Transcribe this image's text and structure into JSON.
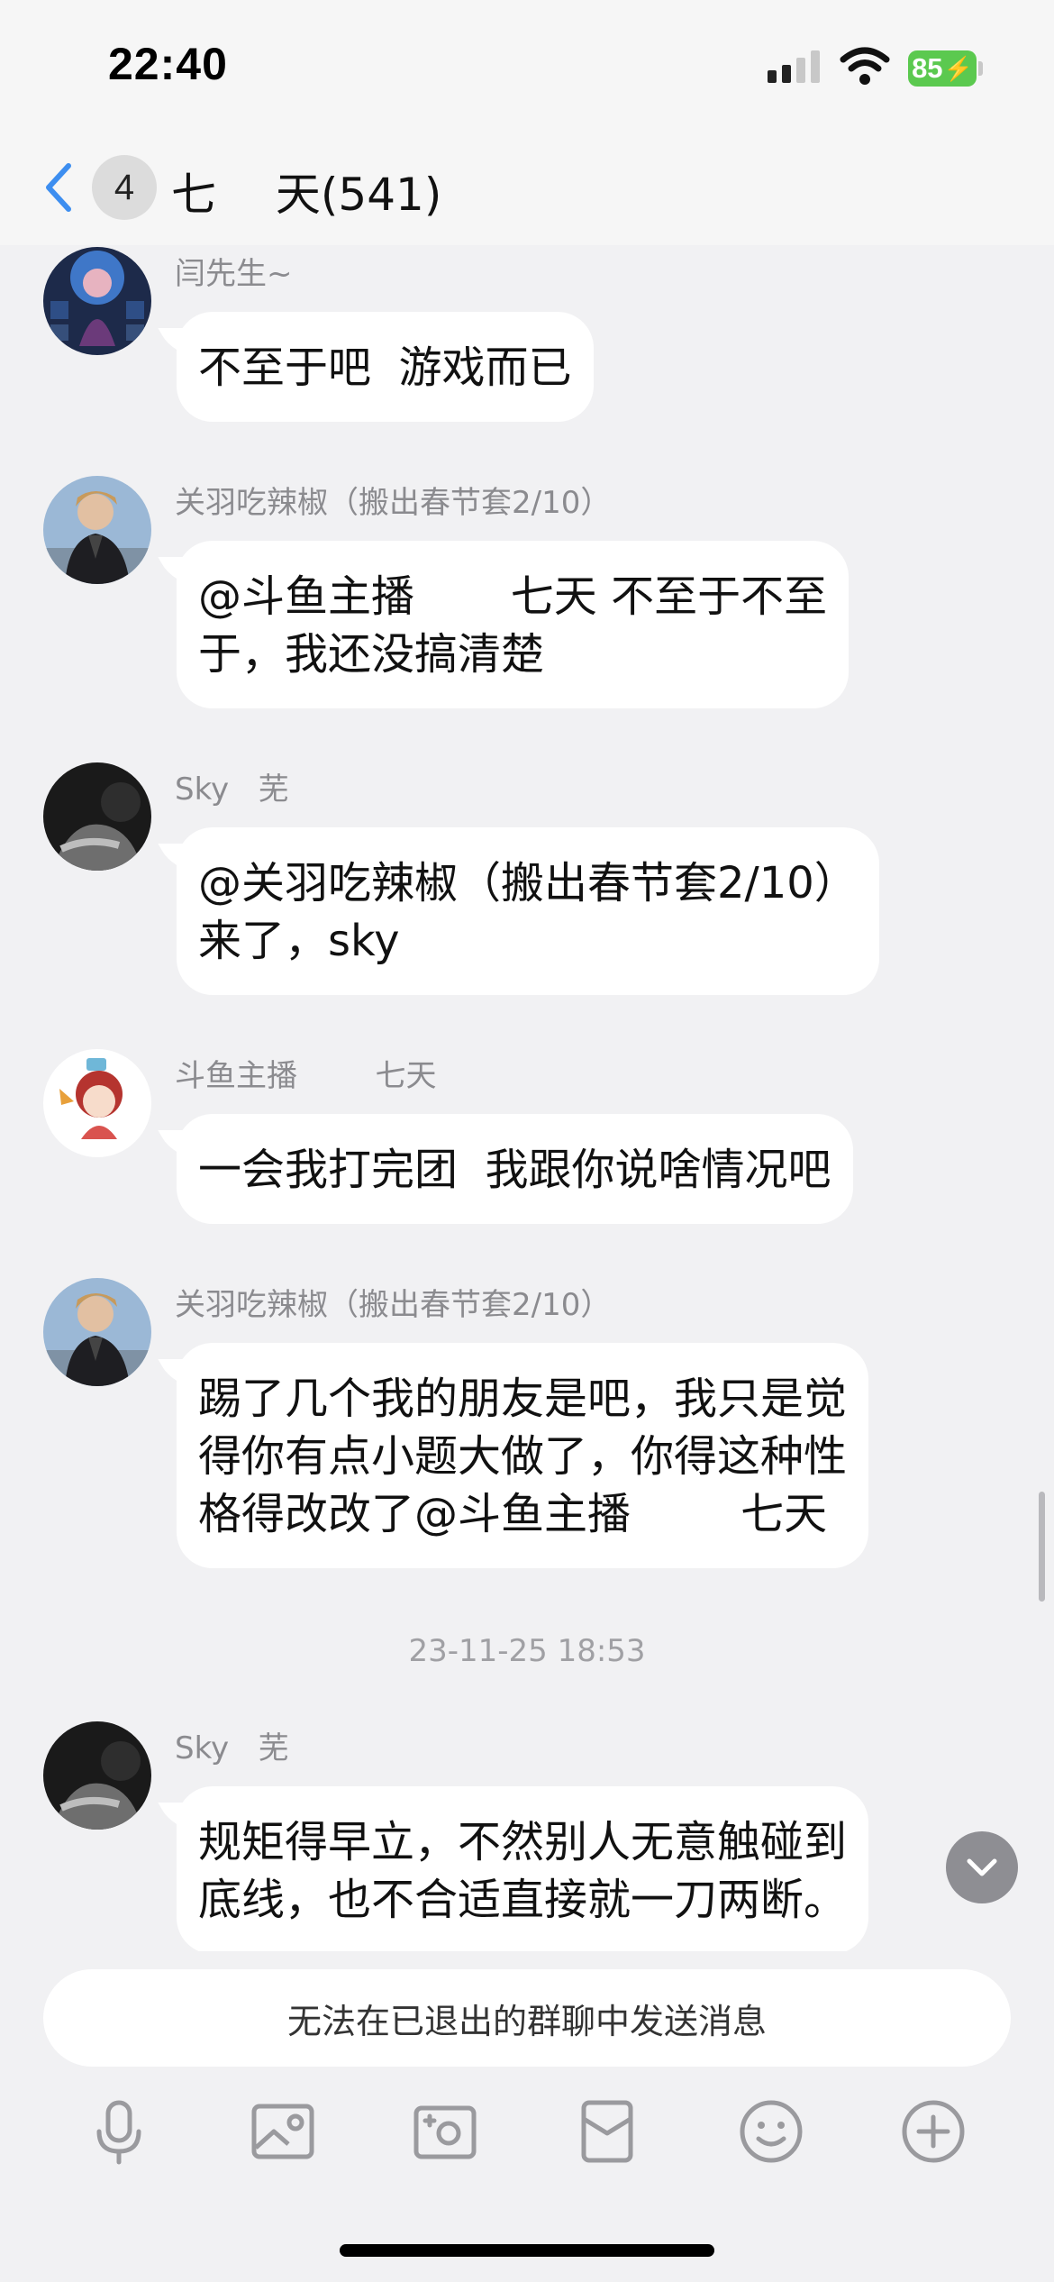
{
  "status_bar": {
    "time": "22:40",
    "battery": "85",
    "battery_color": "#5bc94f"
  },
  "header": {
    "unread_count": "4",
    "title": "七　 天(541)"
  },
  "messages": [
    {
      "sender": "闫先生~",
      "lines": [
        "不至于吧  游戏而已"
      ],
      "avatar": "game-character-avatar"
    },
    {
      "sender": "关羽吃辣椒（搬出春节套2/10）",
      "lines": [
        "@斗鱼主播       七天 不至于不至",
        "于，我还没搞清楚"
      ],
      "avatar": "man-leather-jacket-avatar"
    },
    {
      "sender": "Sky   芜",
      "lines": [
        "@关羽吃辣椒（搬出春节套2/10）",
        "来了，sky"
      ],
      "avatar": "dark-portrait-avatar"
    },
    {
      "sender": "斗鱼主播        七天",
      "lines": [
        "一会我打完团  我跟你说啥情况吧"
      ],
      "avatar": "anime-girl-avatar"
    },
    {
      "sender": "关羽吃辣椒（搬出春节套2/10）",
      "lines": [
        "踢了几个我的朋友是吧，我只是觉",
        "得你有点小题大做了，你得这种性",
        "格得改改了@斗鱼主播        七天"
      ],
      "avatar": "man-leather-jacket-avatar"
    },
    {
      "sender": "Sky   芜",
      "lines": [
        "规矩得早立，不然别人无意触碰到",
        "底线，也不合适直接就一刀两断。"
      ],
      "avatar": "dark-portrait-avatar"
    }
  ],
  "timestamp": "23-11-25 18:53",
  "input": {
    "disabled_text": "无法在已退出的群聊中发送消息"
  },
  "toolbar": {
    "icons": [
      "microphone-icon",
      "photo-icon",
      "camera-icon",
      "red-packet-icon",
      "emoji-icon",
      "plus-icon"
    ]
  },
  "colors": {
    "background": "#f1f1f3",
    "bubble": "#ffffff",
    "accent": "#3d8ef0"
  }
}
